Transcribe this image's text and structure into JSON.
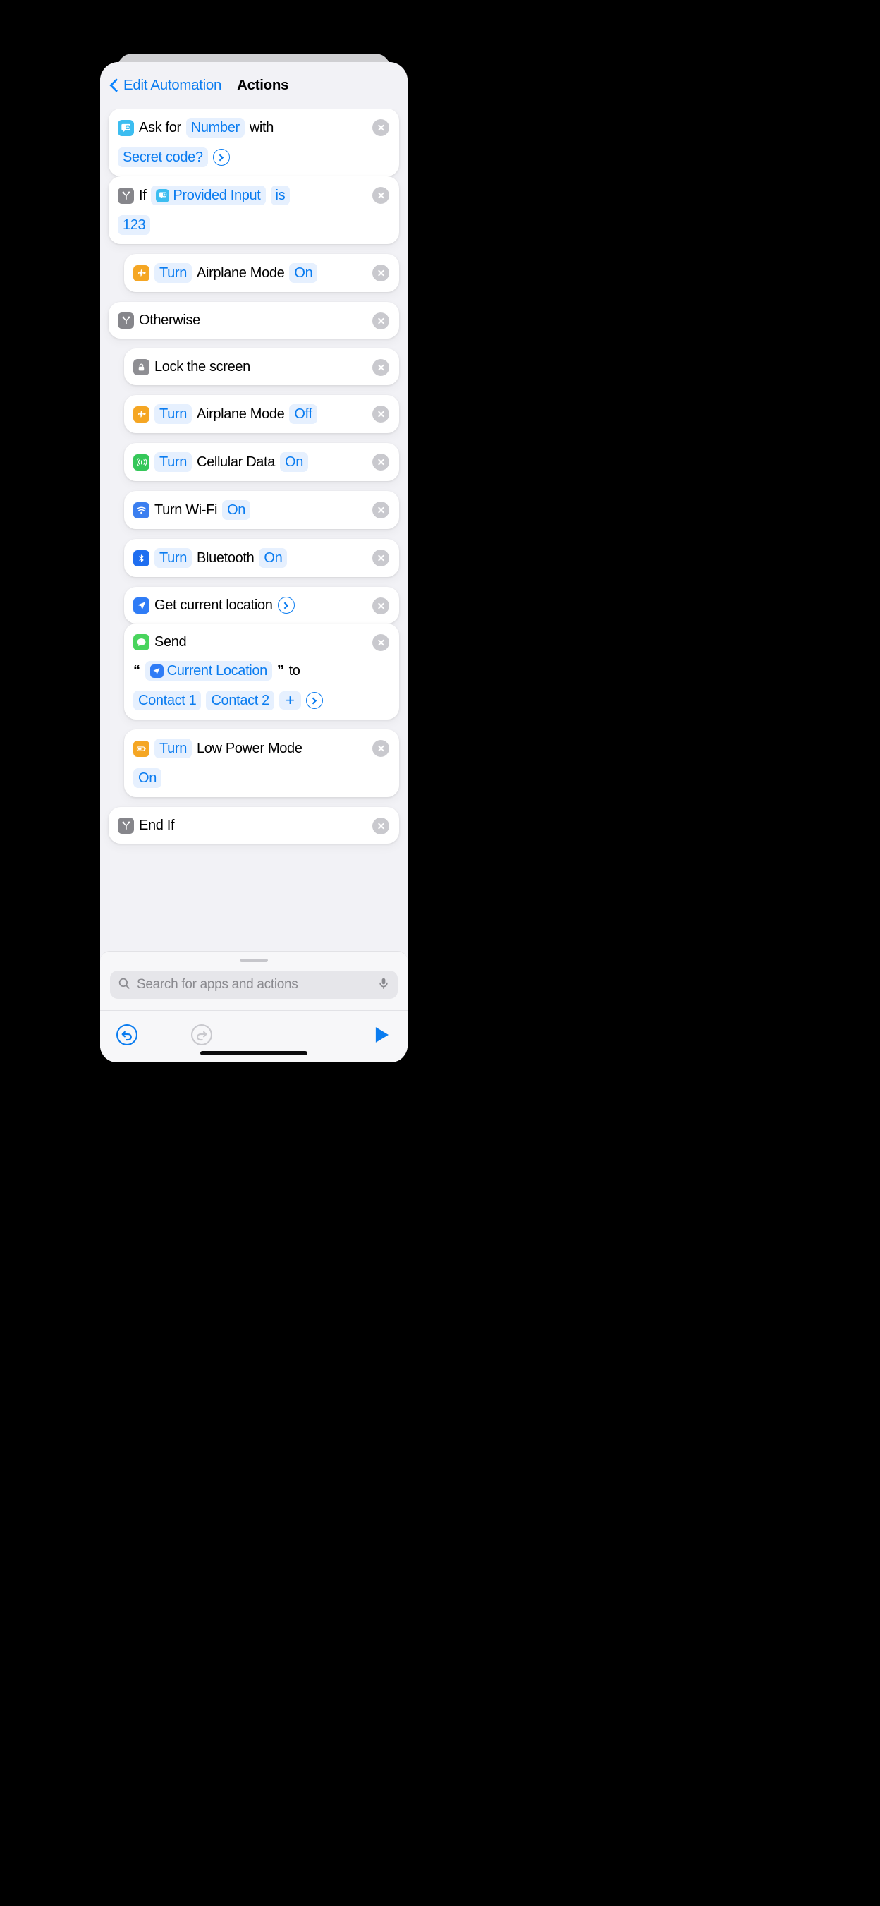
{
  "header": {
    "back_label": "Edit Automation",
    "title": "Actions",
    "back_icon": "chevron-left-icon"
  },
  "colors": {
    "accent": "#0a7cf0",
    "token_bg": "#e6f0fe",
    "sheet_bg": "#f2f2f6",
    "card_bg": "#ffffff",
    "delete_bg": "#c9c9ce",
    "icon_ask": "#3cbdf0",
    "icon_if": "#86868b",
    "icon_airplane": "#f5a623",
    "icon_lock": "#8e8e93",
    "icon_cellular": "#35c759",
    "icon_wifi": "#3b7ff0",
    "icon_bluetooth": "#1f6ef0",
    "icon_location": "#2f7cf6",
    "icon_message": "#49d45d",
    "icon_battery": "#f5a623"
  },
  "actions": [
    {
      "id": "ask-for-number",
      "icon": "ask-input-icon",
      "indent": 0,
      "connector_below": true,
      "line1": [
        {
          "type": "text",
          "value": "Ask for"
        },
        {
          "type": "token",
          "value": "Number"
        },
        {
          "type": "text",
          "value": "with"
        }
      ],
      "line2": [
        {
          "type": "token",
          "value": "Secret code?"
        },
        {
          "type": "chevron",
          "value": "disclosure-chevron"
        }
      ]
    },
    {
      "id": "if-provided-input",
      "icon": "if-branch-icon",
      "indent": 0,
      "connector_below": false,
      "line1": [
        {
          "type": "text",
          "value": "If"
        },
        {
          "type": "var",
          "value": "Provided Input",
          "var_icon": "ask-input-icon"
        },
        {
          "type": "token",
          "value": "is"
        }
      ],
      "line2": [
        {
          "type": "token",
          "value": "123"
        }
      ]
    },
    {
      "id": "turn-airplane-mode-on",
      "icon": "airplane-icon",
      "indent": 1,
      "connector_below": false,
      "line1": [
        {
          "type": "token",
          "value": "Turn"
        },
        {
          "type": "text",
          "value": "Airplane Mode"
        },
        {
          "type": "token",
          "value": "On"
        }
      ],
      "line2": []
    },
    {
      "id": "otherwise",
      "icon": "if-branch-icon",
      "indent": 0,
      "connector_below": false,
      "line1": [
        {
          "type": "text",
          "value": "Otherwise"
        }
      ],
      "line2": []
    },
    {
      "id": "lock-the-screen",
      "icon": "lock-icon",
      "indent": 1,
      "connector_below": false,
      "line1": [
        {
          "type": "text",
          "value": "Lock the screen"
        }
      ],
      "line2": []
    },
    {
      "id": "turn-airplane-mode-off",
      "icon": "airplane-icon",
      "indent": 1,
      "connector_below": false,
      "line1": [
        {
          "type": "token",
          "value": "Turn"
        },
        {
          "type": "text",
          "value": "Airplane Mode"
        },
        {
          "type": "token",
          "value": "Off"
        }
      ],
      "line2": []
    },
    {
      "id": "turn-cellular-data-on",
      "icon": "cellular-icon",
      "indent": 1,
      "connector_below": false,
      "line1": [
        {
          "type": "token",
          "value": "Turn"
        },
        {
          "type": "text",
          "value": "Cellular Data"
        },
        {
          "type": "token",
          "value": "On"
        }
      ],
      "line2": []
    },
    {
      "id": "turn-wifi-on",
      "icon": "wifi-icon",
      "indent": 1,
      "connector_below": false,
      "line1": [
        {
          "type": "text",
          "value": "Turn Wi-Fi"
        },
        {
          "type": "token",
          "value": "On"
        }
      ],
      "line2": []
    },
    {
      "id": "turn-bluetooth-on",
      "icon": "bluetooth-icon",
      "indent": 1,
      "connector_below": false,
      "line1": [
        {
          "type": "token",
          "value": "Turn"
        },
        {
          "type": "text",
          "value": "Bluetooth"
        },
        {
          "type": "token",
          "value": "On"
        }
      ],
      "line2": []
    },
    {
      "id": "get-current-location",
      "icon": "location-icon",
      "indent": 1,
      "connector_below": true,
      "line1": [
        {
          "type": "text",
          "value": "Get current location"
        },
        {
          "type": "chevron",
          "value": "disclosure-chevron"
        }
      ],
      "line2": []
    },
    {
      "id": "send-message",
      "icon": "message-icon",
      "indent": 1,
      "connector_below": false,
      "line1": [
        {
          "type": "text",
          "value": "Send"
        }
      ],
      "line2": [
        {
          "type": "quote",
          "value": "“"
        },
        {
          "type": "var",
          "value": "Current Location",
          "var_icon": "location-icon"
        },
        {
          "type": "quote",
          "value": "”"
        },
        {
          "type": "text",
          "value": "to"
        }
      ],
      "line3": [
        {
          "type": "token",
          "value": "Contact 1"
        },
        {
          "type": "token",
          "value": "Contact 2"
        },
        {
          "type": "plus",
          "value": "+"
        },
        {
          "type": "chevron",
          "value": "disclosure-chevron"
        }
      ]
    },
    {
      "id": "turn-low-power-mode-on",
      "icon": "battery-icon",
      "indent": 1,
      "connector_below": false,
      "line1": [
        {
          "type": "token",
          "value": "Turn"
        },
        {
          "type": "text",
          "value": "Low Power Mode"
        }
      ],
      "line2": [
        {
          "type": "token",
          "value": "On"
        }
      ]
    },
    {
      "id": "end-if",
      "icon": "if-branch-icon",
      "indent": 0,
      "connector_below": false,
      "line1": [
        {
          "type": "text",
          "value": "End If"
        }
      ],
      "line2": []
    }
  ],
  "search": {
    "placeholder": "Search for apps and actions",
    "search_icon": "search-icon",
    "mic_icon": "microphone-icon"
  },
  "toolbar": {
    "undo_icon": "undo-icon",
    "undo_enabled": true,
    "redo_icon": "redo-icon",
    "redo_enabled": false,
    "run_icon": "play-icon"
  }
}
